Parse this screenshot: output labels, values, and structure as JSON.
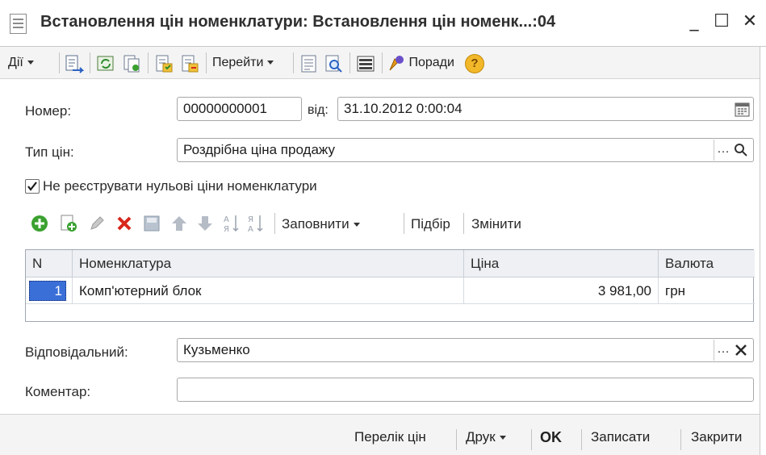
{
  "window": {
    "title": "Встановлення цін номенклатури: Встановлення цін номенк...:04",
    "minimize": "_",
    "maximize": "☐",
    "close": "✕"
  },
  "toolbar": {
    "actions_label": "Дії",
    "goto_label": "Перейти",
    "tips_label": "Поради",
    "help_label": "?"
  },
  "form": {
    "number_label": "Номер:",
    "number_value": "00000000001",
    "from_label": "від:",
    "date_value": "31.10.2012  0:00:04",
    "price_type_label": "Тип цін:",
    "price_type_value": "Роздрібна ціна продажу",
    "zero_prices_checkbox_label": "Не реєструвати нульові ціни номенклатури",
    "zero_prices_checked": true,
    "responsible_label": "Відповідальний:",
    "responsible_value": "Кузьменко",
    "comment_label": "Коментар:",
    "comment_value": ""
  },
  "table_toolbar": {
    "fill_label": "Заповнити",
    "select_label": "Підбір",
    "change_label": "Змінити"
  },
  "table": {
    "columns": [
      "N",
      "Номенклатура",
      "Ціна",
      "Валюта"
    ],
    "rows": [
      {
        "n": "1",
        "item": "Комп'ютерний блок",
        "price": "3 981,00",
        "currency": "грн"
      }
    ]
  },
  "bottom": {
    "price_list_label": "Перелік цін",
    "print_label": "Друк",
    "ok_label": "OK",
    "save_label": "Записати",
    "close_label": "Закрити"
  },
  "colors": {
    "accent_blue": "#2b62c4",
    "add_green": "#3aa12f",
    "delete_red": "#d8261b",
    "tips_orange": "#e79a16"
  }
}
